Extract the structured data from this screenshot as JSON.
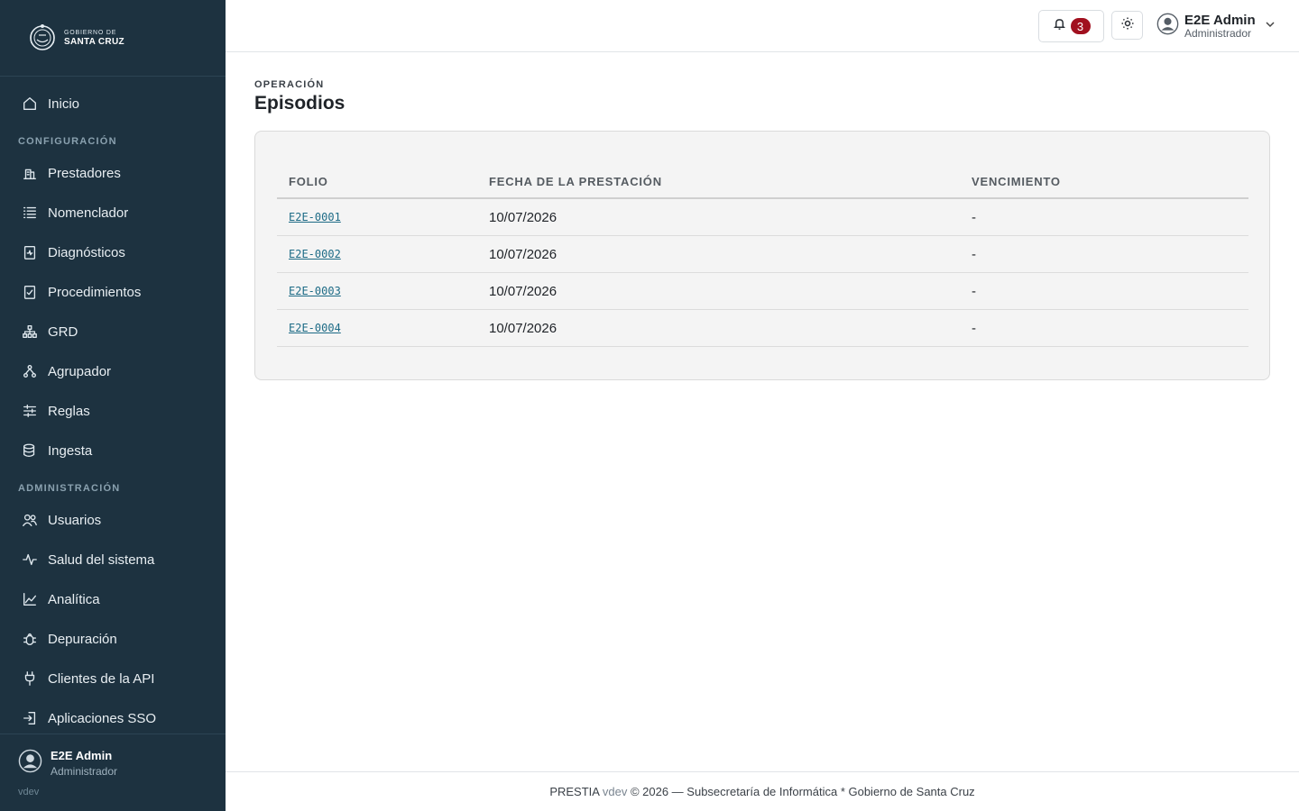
{
  "brand": {
    "line1": "GOBIERNO DE",
    "line2": "SANTA CRUZ"
  },
  "sidebar": {
    "items": [
      {
        "label": "Inicio",
        "icon": "home-icon"
      },
      {
        "label": "Prestadores",
        "icon": "building-icon"
      },
      {
        "label": "Nomenclador",
        "icon": "list-icon"
      },
      {
        "label": "Diagnósticos",
        "icon": "clipboard-pulse-icon"
      },
      {
        "label": "Procedimientos",
        "icon": "clipboard-check-icon"
      },
      {
        "label": "GRD",
        "icon": "hierarchy-icon"
      },
      {
        "label": "Agrupador",
        "icon": "network-icon"
      },
      {
        "label": "Reglas",
        "icon": "sliders-icon"
      },
      {
        "label": "Ingesta",
        "icon": "database-icon"
      },
      {
        "label": "Usuarios",
        "icon": "users-icon"
      },
      {
        "label": "Salud del sistema",
        "icon": "activity-icon"
      },
      {
        "label": "Analítica",
        "icon": "chart-line-icon"
      },
      {
        "label": "Depuración",
        "icon": "bug-icon"
      },
      {
        "label": "Clientes de la API",
        "icon": "plug-icon"
      },
      {
        "label": "Aplicaciones SSO",
        "icon": "sign-in-icon"
      }
    ],
    "sections": {
      "config": "CONFIGURACIÓN",
      "admin": "ADMINISTRACIÓN"
    },
    "user": {
      "name": "E2E Admin",
      "role": "Administrador"
    },
    "version": "vdev"
  },
  "topbar": {
    "notifications_count": "3",
    "user": {
      "name": "E2E Admin",
      "role": "Administrador"
    }
  },
  "main": {
    "eyebrow": "OPERACIÓN",
    "title": "Episodios",
    "table": {
      "columns": [
        "FOLIO",
        "FECHA DE LA PRESTACIÓN",
        "VENCIMIENTO"
      ],
      "rows": [
        {
          "folio": "E2E-0001",
          "fecha": "10/07/2026",
          "vencimiento": "-"
        },
        {
          "folio": "E2E-0002",
          "fecha": "10/07/2026",
          "vencimiento": "-"
        },
        {
          "folio": "E2E-0003",
          "fecha": "10/07/2026",
          "vencimiento": "-"
        },
        {
          "folio": "E2E-0004",
          "fecha": "10/07/2026",
          "vencimiento": "-"
        }
      ]
    }
  },
  "footer": {
    "app": "PRESTIA",
    "version": "vdev",
    "rest": "© 2026 — Subsecretaría de Informática * Gobierno de Santa Cruz"
  },
  "colors": {
    "sidebar_bg": "#1d3240",
    "link": "#1d6b86",
    "badge": "#a1101f"
  }
}
